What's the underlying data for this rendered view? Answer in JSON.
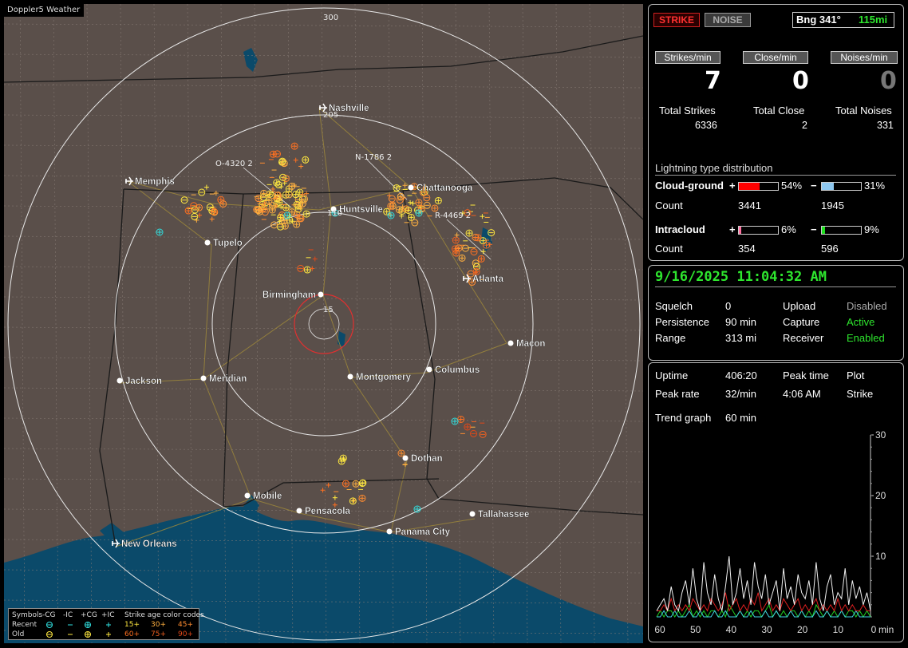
{
  "app": {
    "title": "Doppler5 Weather"
  },
  "map": {
    "ring_labels": [
      "300",
      "205",
      "110",
      "15"
    ],
    "cities": [
      "Nashville",
      "Memphis",
      "Chattanooga",
      "Huntsville",
      "Tupelo",
      "Atlanta",
      "Birmingham",
      "Macon",
      "Jackson",
      "Meridian",
      "Montgomery",
      "Columbus",
      "Dothan",
      "Mobile",
      "Pensacola",
      "Tallahassee",
      "Panama City",
      "New Orleans"
    ],
    "storm_labels": [
      "O-4320 2",
      "N-1786 2",
      "R-4469 2"
    ],
    "colors": {
      "land": "#5a4f4a",
      "water": "#0b4a6a",
      "rings": "#e8e8e8",
      "close_ring": "#e03030"
    }
  },
  "legend": {
    "symbols_label": "Symbols",
    "cols": [
      "-CG",
      "-IC",
      "+CG",
      "+IC"
    ],
    "recent_label": "Recent",
    "old_label": "Old",
    "age_title": "Strike age color codes",
    "recent_ages": [
      "15+",
      "30+",
      "45+"
    ],
    "old_ages": [
      "60+",
      "75+",
      "90+"
    ],
    "age_colors": [
      "#ffe840",
      "#ffb040",
      "#ff8c30",
      "#ff7020",
      "#f06020",
      "#e04818"
    ]
  },
  "panel": {
    "strike_btn": "STRIKE",
    "noise_btn": "NOISE",
    "bearing": "Bng 341°",
    "distance": "115mi",
    "rates": [
      {
        "label": "Strikes/min",
        "value": "7"
      },
      {
        "label": "Close/min",
        "value": "0"
      },
      {
        "label": "Noises/min",
        "value": "0"
      }
    ],
    "totals": [
      {
        "label": "Total Strikes",
        "value": "6336"
      },
      {
        "label": "Total Close",
        "value": "2"
      },
      {
        "label": "Total Noises",
        "value": "331"
      }
    ],
    "dist_title": "Lightning type distribution",
    "cg": {
      "label": "Cloud-ground",
      "pos_pct": "54%",
      "neg_pct": "31%",
      "pos_count": "3441",
      "neg_count": "1945",
      "pos_fill": 0.54,
      "neg_fill": 0.31
    },
    "ic": {
      "label": "Intracloud",
      "pos_pct": "6%",
      "neg_pct": "9%",
      "pos_count": "354",
      "neg_count": "596",
      "pos_fill": 0.06,
      "neg_fill": 0.09
    },
    "count_label": "Count",
    "plus": "+",
    "minus": "−",
    "datetime": "9/16/2025 11:04:32 AM",
    "settings": [
      {
        "label": "Squelch",
        "value": "0",
        "label2": "Upload",
        "value2": "Disabled",
        "status2": "gray"
      },
      {
        "label": "Persistence",
        "value": "90 min",
        "label2": "Capture",
        "value2": "Active",
        "status2": "green"
      },
      {
        "label": "Range",
        "value": "313 mi",
        "label2": "Receiver",
        "value2": "Enabled",
        "status2": "green"
      }
    ],
    "stats": {
      "uptime_label": "Uptime",
      "uptime": "406:20",
      "peaktime_label": "Peak time",
      "plot_label": "Plot",
      "peakrate_label": "Peak rate",
      "peakrate": "32/min",
      "peaktime": "4:06 AM",
      "plot_value": "Strike",
      "trend_label": "Trend graph",
      "trend_value": "60 min"
    },
    "trend": {
      "y_ticks": [
        "30",
        "20",
        "10"
      ],
      "x_ticks": [
        "60",
        "50",
        "40",
        "30",
        "20",
        "10",
        "0"
      ],
      "x_unit": "min",
      "y_max": 30,
      "white": [
        1,
        2,
        3,
        1,
        5,
        2,
        1,
        4,
        6,
        2,
        8,
        3,
        1,
        9,
        4,
        2,
        7,
        3,
        1,
        5,
        10,
        2,
        4,
        8,
        3,
        6,
        2,
        9,
        5,
        3,
        7,
        2,
        4,
        6,
        1,
        8,
        3,
        5,
        2,
        7,
        4,
        3,
        6,
        2,
        9,
        3,
        1,
        5,
        7,
        2,
        4,
        3,
        8,
        2,
        6,
        3,
        5,
        2,
        4,
        1
      ],
      "red": [
        1,
        1,
        2,
        1,
        3,
        1,
        2,
        1,
        2,
        1,
        3,
        2,
        1,
        2,
        1,
        3,
        2,
        1,
        2,
        4,
        1,
        2,
        3,
        1,
        2,
        1,
        3,
        2,
        4,
        1,
        2,
        3,
        1,
        2,
        1,
        3,
        2,
        1,
        2,
        3,
        1,
        2,
        1,
        2,
        3,
        1,
        2,
        1,
        2,
        1,
        3,
        1,
        2,
        1,
        2,
        1,
        1,
        2,
        1,
        1
      ],
      "green": [
        0,
        1,
        0,
        1,
        1,
        0,
        1,
        0,
        1,
        2,
        0,
        1,
        0,
        1,
        0,
        1,
        1,
        0,
        1,
        0,
        2,
        1,
        0,
        1,
        0,
        1,
        0,
        1,
        1,
        0,
        1,
        2,
        0,
        1,
        0,
        1,
        0,
        1,
        1,
        0,
        1,
        0,
        1,
        0,
        2,
        1,
        0,
        1,
        0,
        1,
        0,
        1,
        0,
        1,
        1,
        0,
        1,
        0,
        1,
        0
      ],
      "cyan": [
        0,
        0,
        1,
        0,
        0,
        1,
        0,
        0,
        0,
        1,
        0,
        0,
        1,
        0,
        0,
        0,
        1,
        0,
        0,
        1,
        0,
        0,
        0,
        1,
        0,
        0,
        1,
        0,
        0,
        0,
        1,
        0,
        0,
        1,
        0,
        0,
        0,
        1,
        0,
        0,
        1,
        0,
        0,
        0,
        1,
        0,
        0,
        1,
        0,
        0,
        0,
        1,
        0,
        0,
        0,
        1,
        0,
        0,
        0,
        0
      ]
    }
  }
}
